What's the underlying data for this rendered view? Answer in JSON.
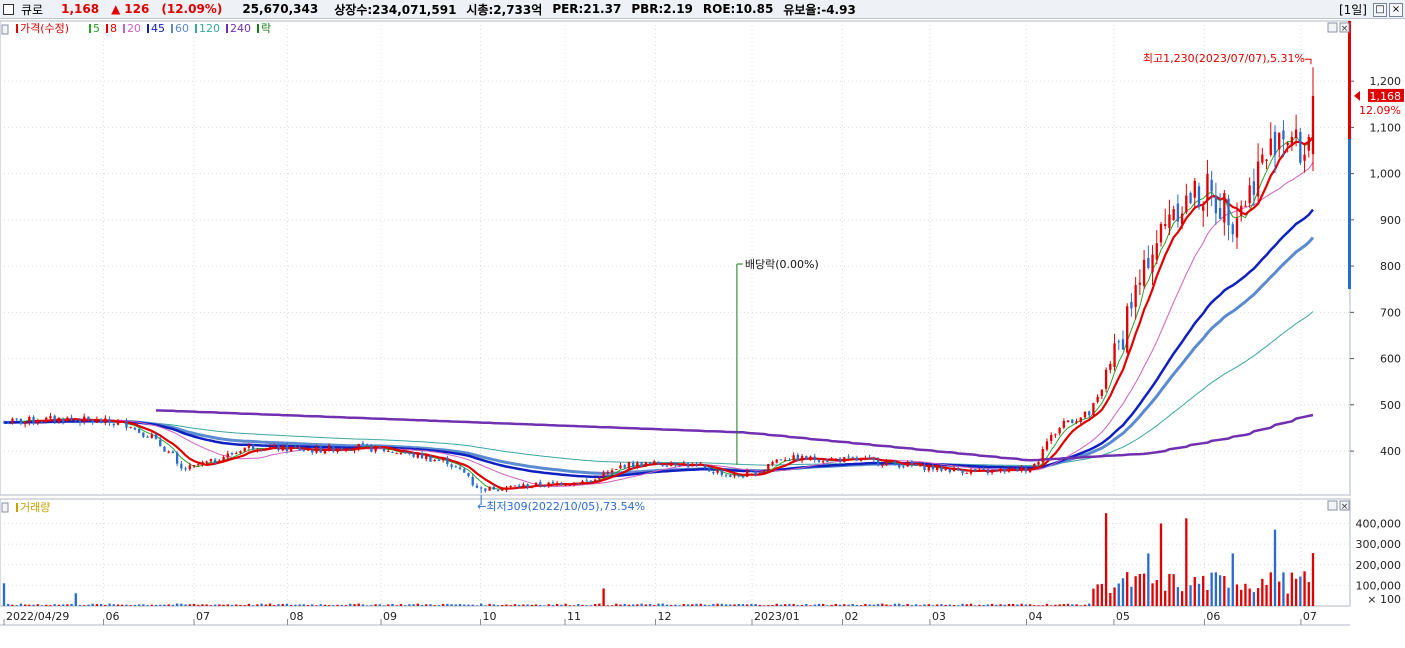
{
  "header": {
    "stock_name": "큐로",
    "price": "1,168",
    "change_arrow": "▲",
    "change": "126",
    "change_pct": "(12.09%)",
    "volume": "25,670,343",
    "stats": [
      "상장수:234,071,591",
      "시총:2,733억",
      "PER:21.37",
      "PBR:2.19",
      "ROE:10.85",
      "유보율:-4.93"
    ],
    "period": "[1일]",
    "window_buttons": [
      "□",
      "×"
    ]
  },
  "price_panel": {
    "legend": [
      {
        "label": "가격(수정)",
        "color": "#e00000"
      },
      {
        "label": "5",
        "color": "#2aa52a"
      },
      {
        "label": "8",
        "color": "#e00000"
      },
      {
        "label": "20",
        "color": "#d060c0"
      },
      {
        "label": "45",
        "color": "#1020c0"
      },
      {
        "label": "60",
        "color": "#5a8ad0"
      },
      {
        "label": "120",
        "color": "#3aa6a0"
      },
      {
        "label": "240",
        "color": "#7030b0"
      },
      {
        "label": "락",
        "color": "#1a7a1a"
      }
    ],
    "current_price_tag": "1,168",
    "current_pct_tag": "12.09%",
    "annotations": {
      "high": "최고1,230(2023/07/07),5.31%",
      "low": "최저309(2022/10/05),73.54%",
      "dividend": "배당락(0.00%)"
    }
  },
  "volume_panel": {
    "legend": [
      {
        "label": "거래량",
        "color": "#c8a000"
      }
    ],
    "unit": "× 100"
  },
  "colors": {
    "up": "#e00000",
    "down": "#2a6bd0",
    "ma5": "#2aa52a",
    "ma8": "#e00000",
    "ma20": "#d060c0",
    "ma45": "#1020c0",
    "ma60": "#5a8ad0",
    "ma120": "#3aa6a0",
    "ma240": "#7030b0"
  },
  "chart_data": {
    "type": "candlestick",
    "x_start": "2022/04/29",
    "x_end": "2023/07/07",
    "x_tick_labels": [
      "2022/04/29",
      "06",
      "07",
      "08",
      "09",
      "10",
      "11",
      "12",
      "2023/01",
      "02",
      "03",
      "04",
      "05",
      "06",
      "07"
    ],
    "y_ticks": [
      400,
      500,
      600,
      700,
      800,
      900,
      1000,
      1100,
      1200
    ],
    "y_range": [
      305,
      1330
    ],
    "volume_ticks": [
      100000,
      200000,
      300000,
      400000
    ],
    "volume_range": [
      0,
      480000
    ],
    "price_path_anchors": [
      {
        "date": "2022-04-29",
        "close": 462
      },
      {
        "date": "2022-05-20",
        "close": 470
      },
      {
        "date": "2022-06-10",
        "close": 458
      },
      {
        "date": "2022-06-20",
        "close": 420
      },
      {
        "date": "2022-06-28",
        "close": 360
      },
      {
        "date": "2022-07-08",
        "close": 378
      },
      {
        "date": "2022-07-20",
        "close": 410
      },
      {
        "date": "2022-08-10",
        "close": 402
      },
      {
        "date": "2022-08-25",
        "close": 410
      },
      {
        "date": "2022-09-10",
        "close": 395
      },
      {
        "date": "2022-09-25",
        "close": 375
      },
      {
        "date": "2022-10-05",
        "close": 318
      },
      {
        "date": "2022-10-20",
        "close": 325
      },
      {
        "date": "2022-11-10",
        "close": 335
      },
      {
        "date": "2022-11-22",
        "close": 370
      },
      {
        "date": "2022-12-10",
        "close": 375
      },
      {
        "date": "2022-12-28",
        "close": 345
      },
      {
        "date": "2023-01-05",
        "close": 355
      },
      {
        "date": "2023-01-12",
        "close": 385
      },
      {
        "date": "2023-02-10",
        "close": 380
      },
      {
        "date": "2023-03-05",
        "close": 362
      },
      {
        "date": "2023-03-20",
        "close": 355
      },
      {
        "date": "2023-04-05",
        "close": 362
      },
      {
        "date": "2023-04-15",
        "close": 460
      },
      {
        "date": "2023-04-25",
        "close": 480
      },
      {
        "date": "2023-05-03",
        "close": 610
      },
      {
        "date": "2023-05-12",
        "close": 780
      },
      {
        "date": "2023-05-22",
        "close": 930
      },
      {
        "date": "2023-06-02",
        "close": 960
      },
      {
        "date": "2023-06-12",
        "close": 910
      },
      {
        "date": "2023-06-20",
        "close": 1010
      },
      {
        "date": "2023-06-27",
        "close": 1100
      },
      {
        "date": "2023-07-05",
        "close": 1042
      },
      {
        "date": "2023-07-07",
        "close": 1168
      }
    ],
    "ma240_anchors": [
      {
        "date": "2022-06-20",
        "value": 488
      },
      {
        "date": "2023-01-01",
        "value": 440
      },
      {
        "date": "2023-04-05",
        "value": 380
      },
      {
        "date": "2023-05-15",
        "value": 395
      },
      {
        "date": "2023-06-15",
        "value": 435
      },
      {
        "date": "2023-07-07",
        "value": 478
      }
    ],
    "high_point": {
      "date": "2023-07-07",
      "value": 1230
    },
    "low_point": {
      "date": "2022-10-05",
      "value": 309
    },
    "dividend_date": "2022-12-28",
    "last_volume": 256700
  }
}
